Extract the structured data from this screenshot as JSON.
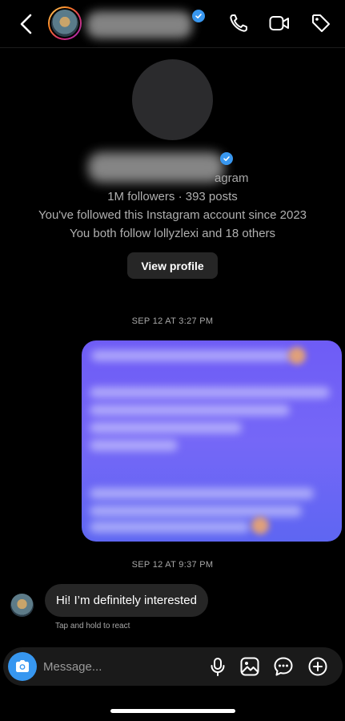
{
  "header": {
    "back_icon": "chevron-left-icon",
    "icons": [
      "phone-icon",
      "video-icon",
      "tag-icon"
    ]
  },
  "profile": {
    "followers_line": "1M followers · 393 posts",
    "followed_since": "You've followed this Instagram account since 2023",
    "mutuals": "You both follow lollyzlexi and 18 others",
    "name_suffix": "agram",
    "view_profile_label": "View profile"
  },
  "messages": [
    {
      "timestamp": "SEP 12 AT 3:27 PM",
      "type": "shared-blurred",
      "bubble_color": "#6e5cf6"
    },
    {
      "timestamp": "SEP 12 AT 9:37 PM",
      "type": "text",
      "text": "Hi! I’m definitely interested",
      "hint": "Tap and hold to react"
    }
  ],
  "composer": {
    "placeholder": "Message...",
    "icons": [
      "camera-icon",
      "microphone-icon",
      "gallery-icon",
      "sticker-icon",
      "plus-icon"
    ],
    "accent": "#3797f0"
  }
}
